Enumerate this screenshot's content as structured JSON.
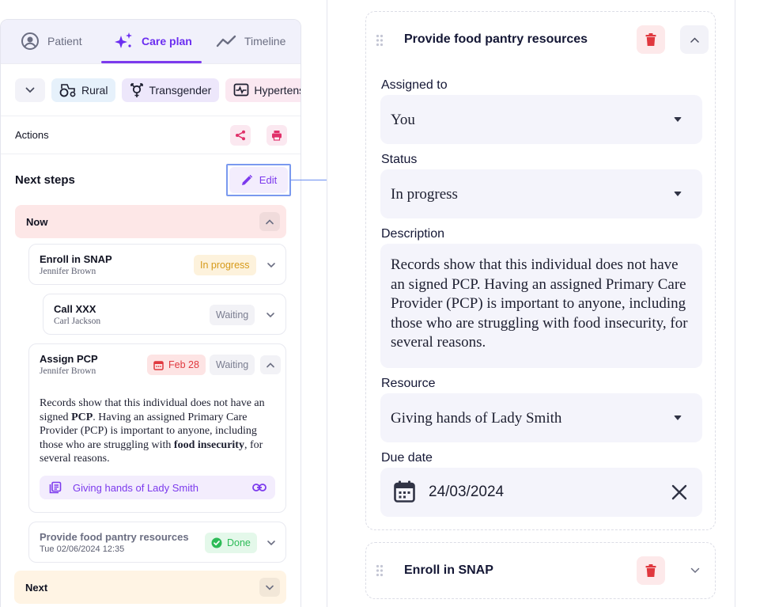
{
  "tabs": [
    {
      "label": "Patient",
      "icon": "user-circle-icon"
    },
    {
      "label": "Care plan",
      "icon": "sparkles-icon"
    },
    {
      "label": "Timeline",
      "icon": "trend-icon"
    }
  ],
  "tags": [
    {
      "label": "Rural",
      "icon": "tractor-icon"
    },
    {
      "label": "Transgender",
      "icon": "transgender-icon"
    },
    {
      "label": "Hypertens",
      "icon": "heart-monitor-icon"
    }
  ],
  "actions": {
    "label": "Actions"
  },
  "next_steps": {
    "title": "Next steps",
    "edit_label": "Edit"
  },
  "sections": {
    "now": "Now",
    "next": "Next"
  },
  "steps": [
    {
      "title": "Enroll in SNAP",
      "person": "Jennifer Brown",
      "status": "In progress"
    },
    {
      "title": "Call XXX",
      "person": "Carl Jackson",
      "status": "Waiting"
    },
    {
      "title": "Assign PCP",
      "person": "Jennifer Brown",
      "due": "Feb 28",
      "status": "Waiting",
      "description": {
        "p1": "Records show that this individual does not have an signed ",
        "b1": "PCP",
        "p2": ". Having an assigned Primary Care Provider (PCP) is important to anyone, including those who are struggling with ",
        "b2": "food insecurity",
        "p3": ", for several reasons."
      },
      "resource": "Giving hands of Lady Smith"
    },
    {
      "title": "Provide food pantry resources",
      "timestamp": "Tue 02/06/2024 12:35",
      "status": "Done"
    }
  ],
  "detail": {
    "title": "Provide food pantry resources",
    "assigned_label": "Assigned to",
    "assigned_value": "You",
    "status_label": "Status",
    "status_value": "In progress",
    "description_label": "Description",
    "description_value": "Records show that this individual does not have an signed PCP. Having an assigned Primary Care Provider (PCP) is important to anyone, including those who are struggling with food insecurity, for several reasons.",
    "resource_label": "Resource",
    "resource_value": "Giving hands of Lady Smith",
    "due_label": "Due date",
    "due_value": "24/03/2024"
  },
  "detail2": {
    "title": "Enroll in SNAP"
  },
  "colors": {
    "accent": "#7c3aed",
    "danger": "#e0383e",
    "success": "#2dbb57",
    "warning": "#d69a1a",
    "connector": "#6b8df0"
  }
}
